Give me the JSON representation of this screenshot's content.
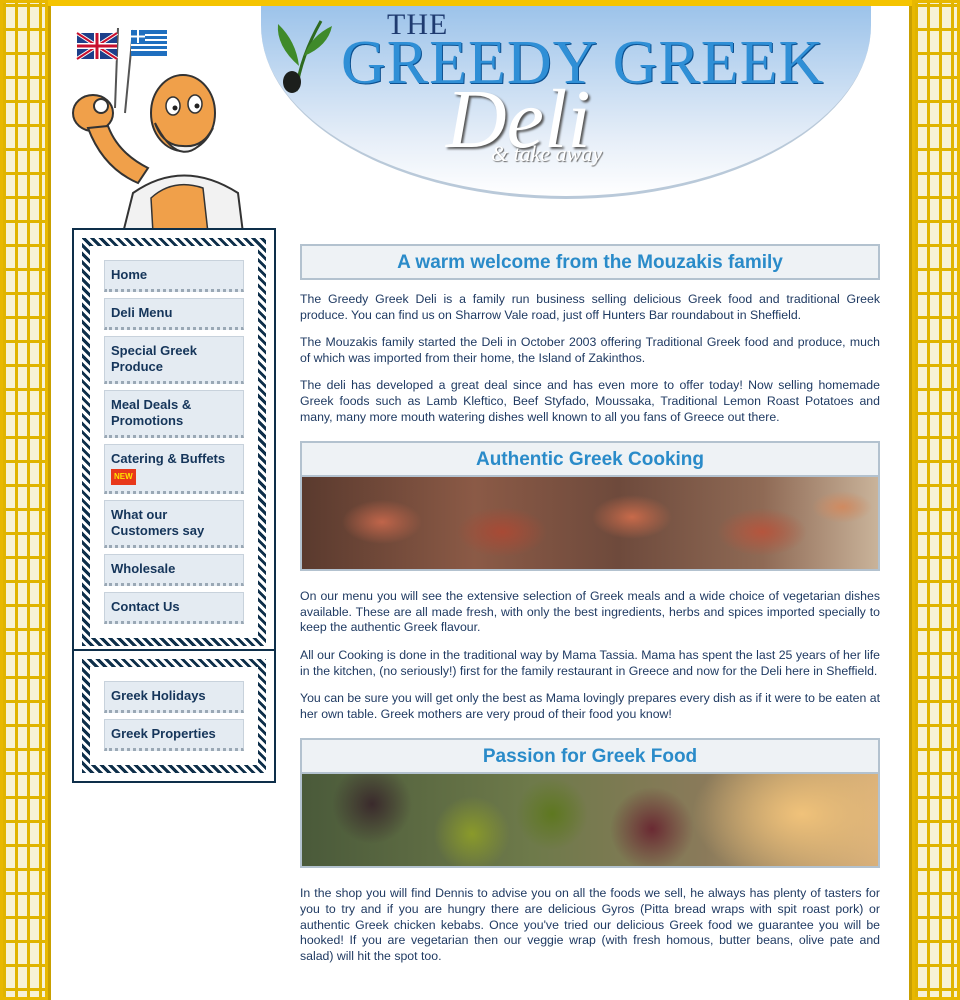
{
  "header": {
    "logo_the": "THE",
    "logo_greedy_greek": "GREEDY GREEK",
    "logo_deli": "Deli",
    "logo_take_away": "& take away"
  },
  "nav_main": [
    {
      "label": "Home"
    },
    {
      "label": "Deli Menu"
    },
    {
      "label": "Special Greek Produce"
    },
    {
      "label": "Meal Deals & Promotions"
    },
    {
      "label": "Catering & Buffets",
      "badge": "NEW"
    },
    {
      "label": "What our Customers say"
    },
    {
      "label": "Wholesale"
    },
    {
      "label": "Contact Us"
    }
  ],
  "nav_secondary": [
    {
      "label": "Greek Holidays"
    },
    {
      "label": "Greek Properties"
    }
  ],
  "sections": [
    {
      "title": "A warm welcome from the Mouzakis family",
      "paragraphs": [
        "The Greedy Greek Deli is a family run business selling delicious Greek food and traditional Greek produce. You can find us on Sharrow Vale road, just off Hunters Bar roundabout in Sheffield.",
        "The Mouzakis family started the Deli in October 2003 offering Traditional Greek food and produce, much of which was imported from their home, the Island of Zakinthos.",
        "The deli has developed a great deal since and has even more to offer today! Now selling homemade Greek foods such as Lamb Kleftico, Beef Styfado, Moussaka, Traditional Lemon Roast Potatoes and many, many more mouth watering dishes well known to all you fans of Greece out there."
      ]
    },
    {
      "title": "Authentic Greek Cooking",
      "paragraphs": [
        "On our menu you will see the extensive selection of Greek meals and a wide choice of vegetarian dishes available. These are all made fresh, with only the best ingredients, herbs and spices imported specially to keep the authentic Greek flavour.",
        "All our Cooking is done in the traditional way by Mama Tassia. Mama has spent the last 25 years of her life in the kitchen, (no seriously!) first for the family restaurant in Greece and now for the Deli here in Sheffield.",
        "You can be sure you will get only the best as Mama lovingly prepares every dish as if it were to be eaten at her own table. Greek mothers are very proud of their food you know!"
      ]
    },
    {
      "title": "Passion for Greek Food",
      "paragraphs": [
        "In the shop you will find Dennis to advise you on all the foods we sell, he always has plenty of tasters for you to try and if you are hungry there are delicious Gyros (Pitta bread wraps with spit roast pork) or authentic Greek chicken kebabs. Once you've tried our delicious Greek food we guarantee you will be hooked! If you are vegetarian then our veggie wrap (with fresh homous, butter beans, olive pate and salad) will hit the spot too."
      ]
    }
  ]
}
